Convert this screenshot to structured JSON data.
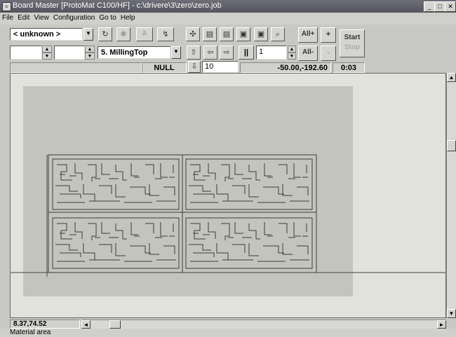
{
  "window": {
    "title": "Board Master [ProtoMat C100/HF] - c:\\drivere\\3\\zero\\zero.job",
    "minimize": "_",
    "maximize": "□",
    "close": "✕"
  },
  "menu": {
    "items": [
      "File",
      "Edit",
      "View",
      "Configuration",
      "Go to",
      "Help"
    ]
  },
  "toolbar": {
    "tool_combo": "< unknown >",
    "phase_combo": "5. MillingTop",
    "all_plus": "All+",
    "all_minus": "All-",
    "plus": "+",
    "minus": "-",
    "start": "Start",
    "stop": "Stop",
    "pause": "||",
    "step_value": "1",
    "move_value": "10"
  },
  "status": {
    "null_label": "NULL",
    "coords": "-50.00,-192.60",
    "time": "0:03",
    "cursor_pos": "8.37,74.52",
    "message": "Material area"
  },
  "colors": {
    "title_bar": "#5e5e68",
    "canvas": "#e2e2dc",
    "material_area": "#c2c2bc",
    "pcb_lines": "#3a3a3a"
  }
}
